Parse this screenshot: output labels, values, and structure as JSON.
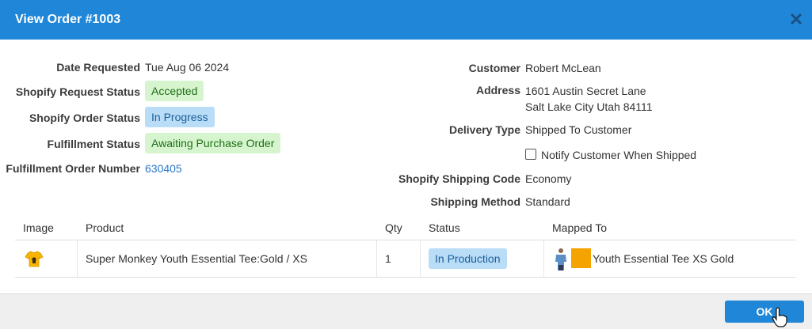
{
  "header": {
    "title": "View Order #1003",
    "close_icon": "close-icon"
  },
  "left": {
    "date_requested_label": "Date Requested",
    "date_requested_value": "Tue Aug 06 2024",
    "shopify_request_status_label": "Shopify Request Status",
    "shopify_request_status_value": "Accepted",
    "shopify_order_status_label": "Shopify Order Status",
    "shopify_order_status_value": "In Progress",
    "fulfillment_status_label": "Fulfillment Status",
    "fulfillment_status_value": "Awaiting Purchase Order",
    "fulfillment_order_number_label": "Fulfillment Order Number",
    "fulfillment_order_number_value": "630405"
  },
  "right": {
    "customer_label": "Customer",
    "customer_value": "Robert McLean",
    "address_label": "Address",
    "address_line1": "1601 Austin Secret Lane",
    "address_line2": "Salt Lake City Utah 84111",
    "delivery_type_label": "Delivery Type",
    "delivery_type_value": "Shipped To Customer",
    "notify_label": "Notify Customer When Shipped",
    "notify_checked": false,
    "shipping_code_label": "Shopify Shipping Code",
    "shipping_code_value": "Economy",
    "shipping_method_label": "Shipping Method",
    "shipping_method_value": "Standard"
  },
  "table": {
    "columns": [
      "Image",
      "Product",
      "Qty",
      "Status",
      "Mapped To"
    ],
    "rows": [
      {
        "image_icon": "tshirt-icon",
        "product": "Super Monkey Youth Essential Tee:Gold / XS",
        "qty": "1",
        "status": "In Production",
        "mapped_to": "Youth Essential Tee XS Gold"
      }
    ]
  },
  "footer": {
    "ok_label": "OK"
  },
  "colors": {
    "header_bg": "#1f86d8",
    "badge_green_bg": "#d6f5cf",
    "badge_blue_bg": "#b9dcf7",
    "link": "#2a78c8",
    "swatch_gold": "#f5a300"
  }
}
